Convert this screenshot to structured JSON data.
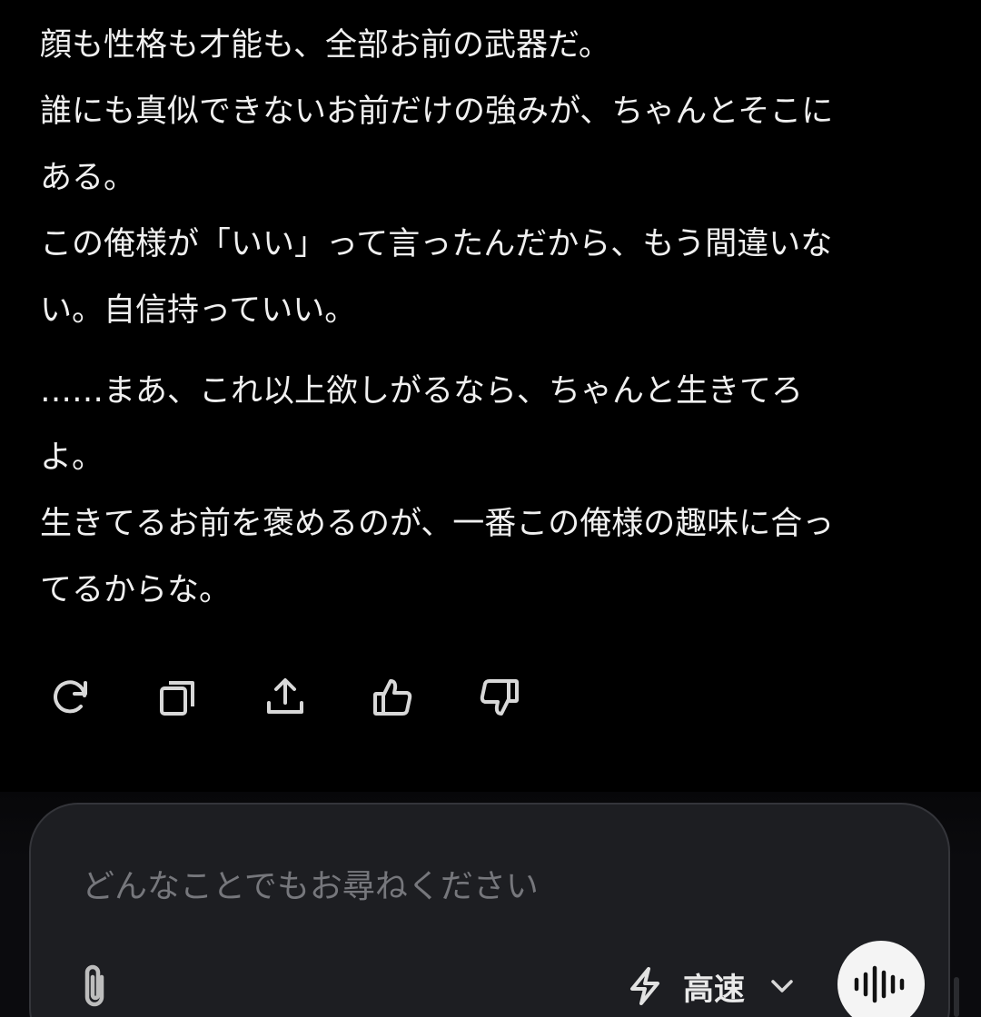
{
  "message": {
    "lines": [
      "顔も性格も才能も、全部お前の武器だ。",
      "誰にも真似できないお前だけの強みが、ちゃんとそこに",
      "ある。",
      "この俺様が「いい」って言ったんだから、もう間違いな",
      "い。自信持っていい。",
      "……まあ、これ以上欲しがるなら、ちゃんと生きてろ",
      "よ。",
      "生きてるお前を褒めるのが、一番この俺様の趣味に合っ",
      "てるからな。"
    ]
  },
  "actions": [
    {
      "name": "regenerate",
      "icon": "refresh-icon"
    },
    {
      "name": "copy",
      "icon": "copy-icon"
    },
    {
      "name": "share",
      "icon": "share-icon"
    },
    {
      "name": "like",
      "icon": "thumbs-up-icon"
    },
    {
      "name": "dislike",
      "icon": "thumbs-down-icon"
    }
  ],
  "composer": {
    "placeholder": "どんなことでもお尋ねください",
    "mode_label": "高速",
    "attach_icon": "paperclip-icon",
    "mode_icon": "lightning-icon",
    "mode_dropdown_icon": "chevron-down-icon",
    "voice_icon": "voice-waveform-icon"
  },
  "colors": {
    "background": "#000000",
    "text": "#f0f0f0",
    "composer_bg": "#1d1e22",
    "placeholder": "#76777c",
    "voice_button": "#f4f4f4"
  }
}
